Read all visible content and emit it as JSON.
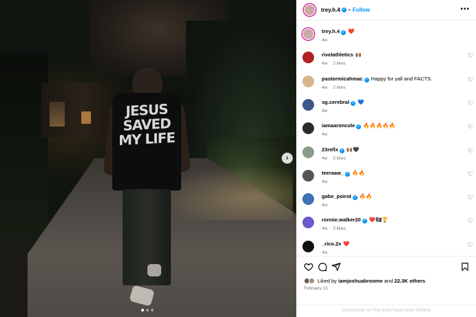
{
  "post": {
    "author": "trey.h.4",
    "follow_label": "Follow",
    "separator": "•",
    "more_label": "•••",
    "shirt_lines": [
      "JESUS",
      "SAVED",
      "MY LIFE"
    ],
    "next_label": "›",
    "carousel": {
      "count": 3,
      "active_index": 0
    }
  },
  "comments": [
    {
      "user": "trey.h.4",
      "verified": true,
      "text": "❤️",
      "time": "4w",
      "likes": "",
      "avatar_color": "#c9a9a6",
      "like_icon": false
    },
    {
      "user": "rivelathletics",
      "verified": false,
      "text": "🙌🏾",
      "time": "4w",
      "likes": "2 likes",
      "avatar_color": "#b22222",
      "like_icon": true
    },
    {
      "user": "pastormicahmac",
      "verified": true,
      "text": "Happy for yall and FACTS.",
      "time": "4w",
      "likes": "2 likes",
      "avatar_color": "#d9b38c",
      "like_icon": true
    },
    {
      "user": "sg.cerebral",
      "verified": true,
      "text": "💙",
      "time": "4w",
      "likes": "",
      "avatar_color": "#3b5a8a",
      "like_icon": true
    },
    {
      "user": "iamaaroncole",
      "verified": true,
      "text": "🔥🔥🔥🔥🔥",
      "time": "4w",
      "likes": "",
      "avatar_color": "#2a2a2a",
      "like_icon": true
    },
    {
      "user": "23rellx",
      "verified": true,
      "text": "🙌🏾🖤",
      "time": "4w",
      "likes": "3 likes",
      "avatar_color": "#8c9a8c",
      "like_icon": true
    },
    {
      "user": "teeraaw_",
      "verified": true,
      "text": "🔥🔥",
      "time": "4w",
      "likes": "",
      "avatar_color": "#555555",
      "like_icon": true
    },
    {
      "user": "gabe_poirot",
      "verified": true,
      "text": "🔥🔥",
      "time": "4w",
      "likes": "",
      "avatar_color": "#3f6fb5",
      "like_icon": true
    },
    {
      "user": "ronnie.walker20",
      "verified": true,
      "text": "❤️🏴‍☠️🏆",
      "time": "4w",
      "likes": "3 likes",
      "avatar_color": "#6a5acd",
      "like_icon": true
    },
    {
      "user": "_rico.2x",
      "verified": false,
      "text": "❤️",
      "time": "4w",
      "likes": "",
      "avatar_color": "#111111",
      "like_icon": true
    }
  ],
  "footer": {
    "liked_by_prefix": "Liked by ",
    "liked_by_user": "iamjoshuabroome",
    "liked_by_suffix": " and ",
    "others": "22.3K others",
    "date": "February 21",
    "limited_notice": "Comments on this post have been limited."
  },
  "colors": {
    "accent": "#0095f6",
    "muted": "#737373",
    "ring": "#d6249f"
  },
  "icons": [
    "heart-icon",
    "comment-icon",
    "share-icon",
    "bookmark-icon",
    "more-icon",
    "chevron-right-icon"
  ]
}
